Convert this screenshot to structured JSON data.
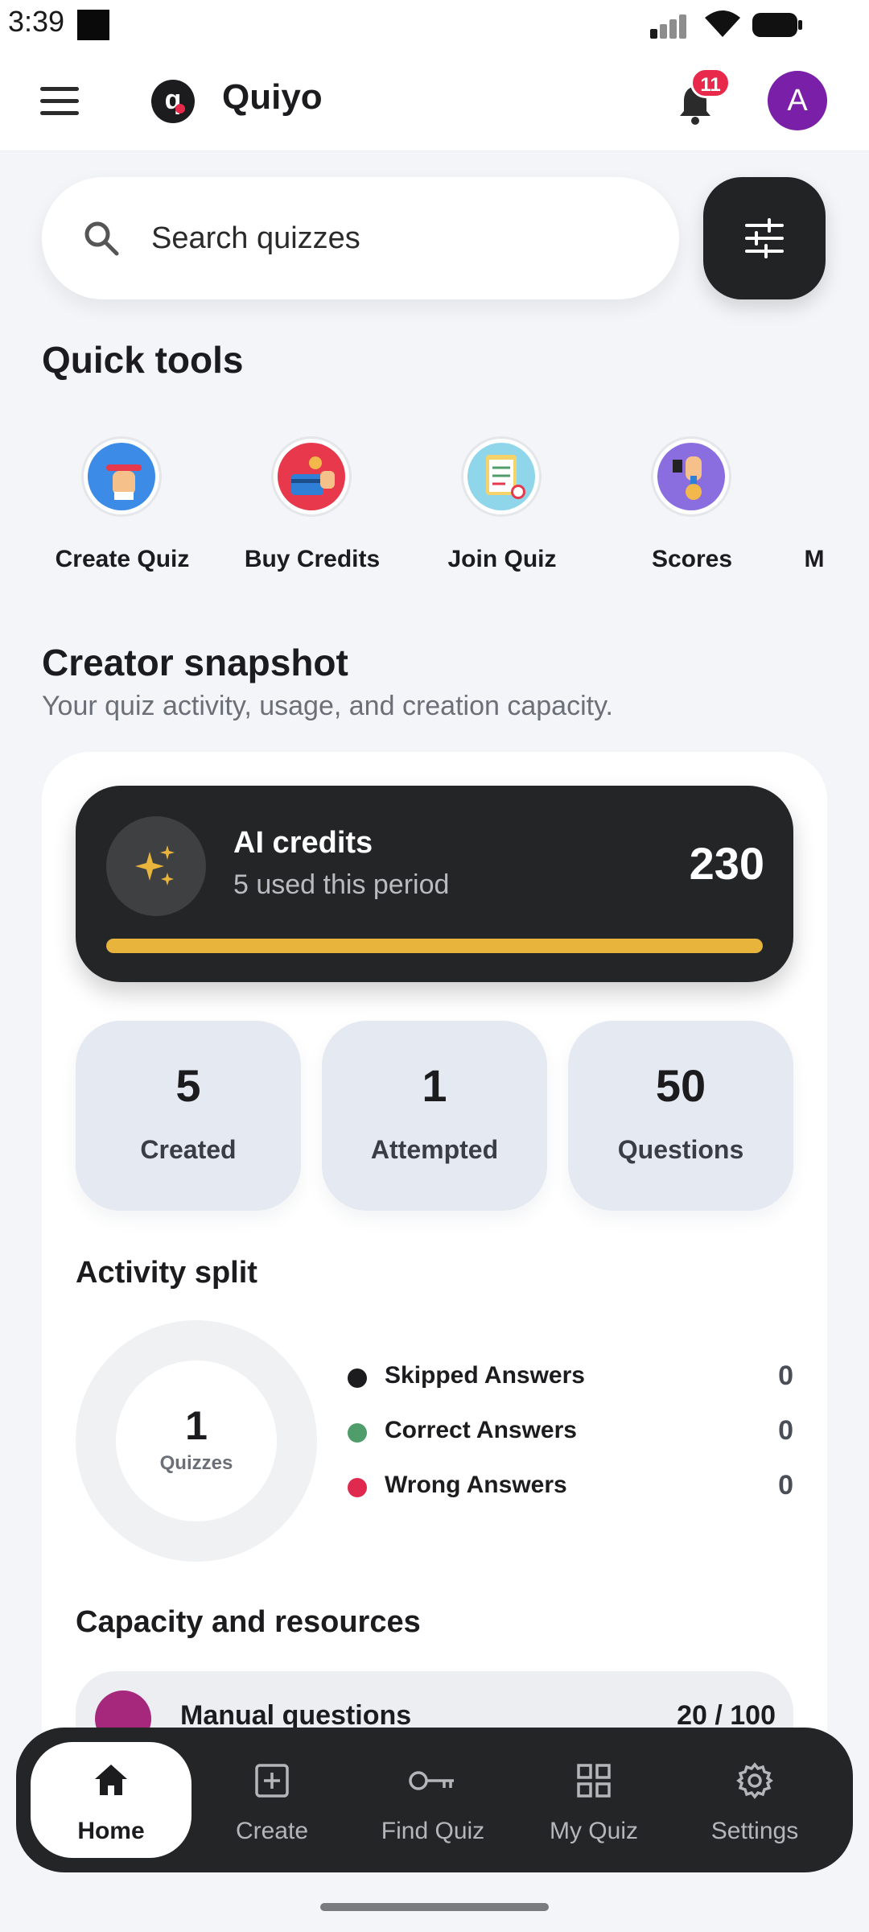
{
  "status_bar": {
    "time": "3:39"
  },
  "header": {
    "brand": "Quiyo",
    "logo_letter": "q",
    "notifications_count": "11",
    "avatar_initial": "A"
  },
  "search": {
    "placeholder": "Search quizzes",
    "value": ""
  },
  "quick_tools": {
    "title": "Quick tools",
    "items": [
      {
        "label": "Create Quiz",
        "icon": "hand-pencil-icon",
        "color": "#3c8ce7"
      },
      {
        "label": "Buy Credits",
        "icon": "credit-card-icon",
        "color": "#e8394c"
      },
      {
        "label": "Join Quiz",
        "icon": "clipboard-checklist-icon",
        "color": "#8fd6ea"
      },
      {
        "label": "Scores",
        "icon": "medal-icon",
        "color": "#8a6ee0"
      },
      {
        "label": "M",
        "icon": "more-tool-icon",
        "color": "#e4e6ea"
      }
    ]
  },
  "snapshot": {
    "title": "Creator snapshot",
    "subtitle": "Your quiz activity, usage, and creation capacity.",
    "credits": {
      "title": "AI credits",
      "subtitle": "5 used this period",
      "value": "230",
      "progress_fraction": 1.0,
      "accent": "#e9b43c"
    },
    "stats": [
      {
        "value": "5",
        "label": "Created"
      },
      {
        "value": "1",
        "label": "Attempted"
      },
      {
        "value": "50",
        "label": "Questions"
      }
    ],
    "activity": {
      "title": "Activity split",
      "center_value": "1",
      "center_label": "Quizzes",
      "legend": [
        {
          "label": "Skipped Answers",
          "value": "0",
          "color": "#1c1c1e"
        },
        {
          "label": "Correct Answers",
          "value": "0",
          "color": "#4f9d6b"
        },
        {
          "label": "Wrong Answers",
          "value": "0",
          "color": "#e0294f"
        }
      ]
    },
    "capacity": {
      "title": "Capacity and resources",
      "items": [
        {
          "label": "Manual questions",
          "value": "20 / 100",
          "icon": "notebook-icon"
        }
      ]
    }
  },
  "bottom_nav": {
    "items": [
      {
        "label": "Home",
        "icon": "home-icon",
        "active": true
      },
      {
        "label": "Create",
        "icon": "plus-square-icon",
        "active": false
      },
      {
        "label": "Find Quiz",
        "icon": "key-icon",
        "active": false
      },
      {
        "label": "My Quiz",
        "icon": "grid-icon",
        "active": false
      },
      {
        "label": "Settings",
        "icon": "gear-icon",
        "active": false
      }
    ]
  }
}
